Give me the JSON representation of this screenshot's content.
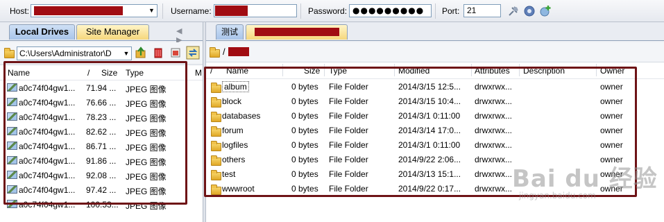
{
  "connection": {
    "host_label": "Host:",
    "username_label": "Username:",
    "password_label": "Password:",
    "password_value": "●●●●●●●●●",
    "port_label": "Port:",
    "port_value": "21"
  },
  "toolbar_icons": [
    "disconnect-icon",
    "settings-gear-icon",
    "add-site-icon"
  ],
  "left_panel": {
    "tabs": [
      {
        "label": "Local Drives"
      },
      {
        "label": "Site Manager"
      }
    ],
    "nav": "◀ ▶",
    "path": "C:\\Users\\Administrator\\D",
    "columns": {
      "name": "Name",
      "sort": "/",
      "size": "Size",
      "type": "Type",
      "more": "M"
    },
    "files": [
      {
        "name": "a0c74f04gw1...",
        "size": "71.94 ...",
        "type": "JPEG 图像"
      },
      {
        "name": "a0c74f04gw1...",
        "size": "76.66 ...",
        "type": "JPEG 图像"
      },
      {
        "name": "a0c74f04gw1...",
        "size": "78.23 ...",
        "type": "JPEG 图像"
      },
      {
        "name": "a0c74f04gw1...",
        "size": "82.62 ...",
        "type": "JPEG 图像"
      },
      {
        "name": "a0c74f04gw1...",
        "size": "86.71 ...",
        "type": "JPEG 图像"
      },
      {
        "name": "a0c74f04gw1...",
        "size": "91.86 ...",
        "type": "JPEG 图像"
      },
      {
        "name": "a0c74f04gw1...",
        "size": "92.08 ...",
        "type": "JPEG 图像"
      },
      {
        "name": "a0c74f04gw1...",
        "size": "97.42 ...",
        "type": "JPEG 图像"
      },
      {
        "name": "a0c74f04gw1...",
        "size": "100.53...",
        "type": "JPEG 图像"
      }
    ]
  },
  "right_panel": {
    "tabs": [
      {
        "label": "测试"
      }
    ],
    "path_prefix": "/",
    "columns": {
      "sort": "/",
      "name": "Name",
      "size": "Size",
      "type": "Type",
      "modified": "Modified",
      "attributes": "Attributes",
      "description": "Description",
      "owner": "Owner"
    },
    "folders": [
      {
        "name": "album",
        "size": "0 bytes",
        "type": "File Folder",
        "modified": "2014/3/15 12:5...",
        "attributes": "drwxrwx...",
        "owner": "owner"
      },
      {
        "name": "block",
        "size": "0 bytes",
        "type": "File Folder",
        "modified": "2014/3/15 10:4...",
        "attributes": "drwxrwx...",
        "owner": "owner"
      },
      {
        "name": "databases",
        "size": "0 bytes",
        "type": "File Folder",
        "modified": "2014/3/1 0:11:00",
        "attributes": "drwxrwx...",
        "owner": "owner"
      },
      {
        "name": "forum",
        "size": "0 bytes",
        "type": "File Folder",
        "modified": "2014/3/14 17:0...",
        "attributes": "drwxrwx...",
        "owner": "owner"
      },
      {
        "name": "logfiles",
        "size": "0 bytes",
        "type": "File Folder",
        "modified": "2014/3/1 0:11:00",
        "attributes": "drwxrwx...",
        "owner": "owner"
      },
      {
        "name": "others",
        "size": "0 bytes",
        "type": "File Folder",
        "modified": "2014/9/22 2:06...",
        "attributes": "drwxrwx...",
        "owner": "owner"
      },
      {
        "name": "test",
        "size": "0 bytes",
        "type": "File Folder",
        "modified": "2014/3/13 15:1...",
        "attributes": "drwxrwx...",
        "owner": "owner"
      },
      {
        "name": "wwwroot",
        "size": "0 bytes",
        "type": "File Folder",
        "modified": "2014/9/22 0:17...",
        "attributes": "drwxrwx...",
        "owner": "owner"
      }
    ]
  },
  "watermark": {
    "main": "Bai du 经验",
    "sub": "jingyan.baidu.com"
  },
  "colors": {
    "annotation": "#6e1316",
    "redaction": "#a00c12",
    "tab_blue": "#a9c5ea",
    "tab_yellow": "#f6d77c"
  }
}
